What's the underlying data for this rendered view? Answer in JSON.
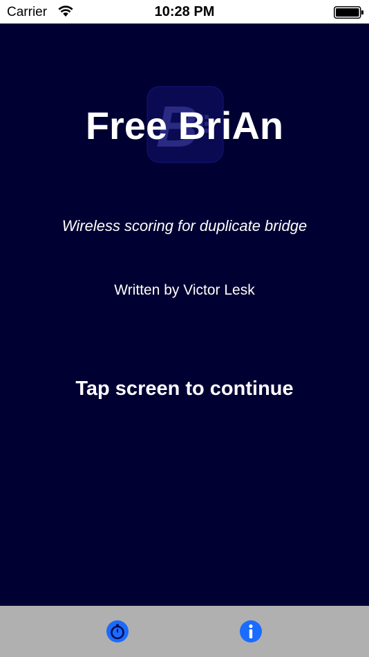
{
  "status_bar": {
    "carrier": "Carrier",
    "time": "10:28 PM",
    "icons": [
      "wifi-icon",
      "battery-icon"
    ]
  },
  "splash": {
    "logo_icon": "app-logo-icon",
    "title": "Free BriAn",
    "tagline": "Wireless scoring for duplicate bridge",
    "author": "Written by Victor Lesk",
    "prompt": "Tap screen to continue"
  },
  "tab_bar": {
    "items": [
      {
        "icon": "stopwatch-icon"
      },
      {
        "icon": "info-icon"
      }
    ]
  },
  "colors": {
    "background": "#000032",
    "tab_bar": "#b0b0b0",
    "accent": "#1a6bff",
    "text": "#ffffff"
  }
}
